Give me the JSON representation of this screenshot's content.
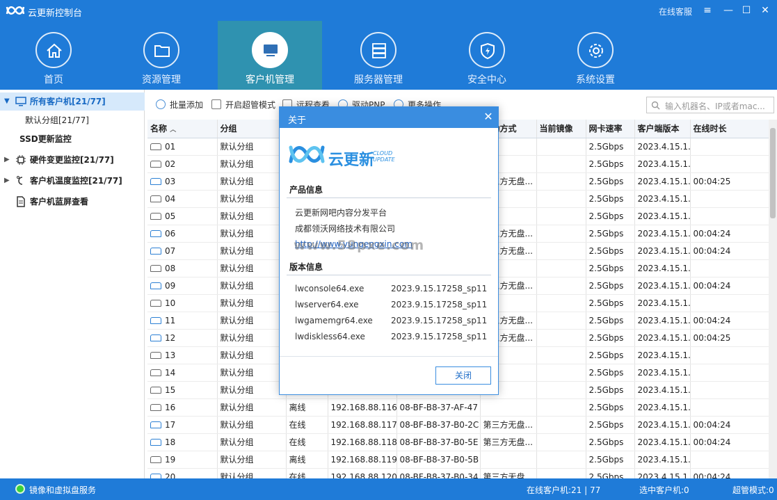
{
  "app": {
    "title": "云更新控制台",
    "online_service": "在线客服"
  },
  "nav": [
    {
      "label": "首页",
      "icon": "home-icon"
    },
    {
      "label": "资源管理",
      "icon": "folder-icon"
    },
    {
      "label": "客户机管理",
      "icon": "monitor-icon"
    },
    {
      "label": "服务器管理",
      "icon": "server-icon"
    },
    {
      "label": "安全中心",
      "icon": "shield-icon"
    },
    {
      "label": "系统设置",
      "icon": "gear-icon"
    }
  ],
  "sidebar": {
    "items": [
      {
        "label": "所有客户机[21/77]"
      },
      {
        "label": "默认分组[21/77]"
      },
      {
        "label": "SSD更新监控"
      },
      {
        "label": "硬件变更监控[21/77]"
      },
      {
        "label": "客户机温度监控[21/77]"
      },
      {
        "label": "客户机蓝屏查看"
      }
    ]
  },
  "toolbar": {
    "batch_add": "批量添加",
    "super_mode": "开启超管模式",
    "remote_view": "远程查看",
    "driver_pnp": "驱动PNP",
    "more": "更多操作",
    "search_placeholder": "输入机器名、IP或者mac..."
  },
  "table": {
    "headers": [
      "名称",
      "分组",
      "",
      "",
      "",
      "启动方式",
      "当前镜像",
      "网卡速率",
      "客户端版本",
      "在线时长"
    ],
    "rows": [
      {
        "name": "01",
        "group": "默认分组",
        "state": "",
        "ip": "",
        "mac": "",
        "boot": "",
        "image": "",
        "speed": "2.5Gbps",
        "ver": "2023.4.15.1...",
        "uptime": "",
        "on": false
      },
      {
        "name": "02",
        "group": "默认分组",
        "state": "",
        "ip": "",
        "mac": "",
        "boot": "",
        "image": "",
        "speed": "2.5Gbps",
        "ver": "2023.4.15.1...",
        "uptime": "",
        "on": false
      },
      {
        "name": "03",
        "group": "默认分组",
        "state": "",
        "ip": "",
        "mac": "",
        "boot": "第三方无盘...",
        "image": "",
        "speed": "2.5Gbps",
        "ver": "2023.4.15.1...",
        "uptime": "00:04:25",
        "on": true
      },
      {
        "name": "04",
        "group": "默认分组",
        "state": "",
        "ip": "",
        "mac": "",
        "boot": "",
        "image": "",
        "speed": "2.5Gbps",
        "ver": "2023.4.15.1...",
        "uptime": "",
        "on": false
      },
      {
        "name": "05",
        "group": "默认分组",
        "state": "",
        "ip": "",
        "mac": "",
        "boot": "",
        "image": "",
        "speed": "2.5Gbps",
        "ver": "2023.4.15.1...",
        "uptime": "",
        "on": false
      },
      {
        "name": "06",
        "group": "默认分组",
        "state": "",
        "ip": "",
        "mac": "",
        "boot": "第三方无盘...",
        "image": "",
        "speed": "2.5Gbps",
        "ver": "2023.4.15.1...",
        "uptime": "00:04:24",
        "on": true
      },
      {
        "name": "07",
        "group": "默认分组",
        "state": "",
        "ip": "",
        "mac": "",
        "boot": "第三方无盘...",
        "image": "",
        "speed": "2.5Gbps",
        "ver": "2023.4.15.1...",
        "uptime": "00:04:24",
        "on": true
      },
      {
        "name": "08",
        "group": "默认分组",
        "state": "",
        "ip": "",
        "mac": "",
        "boot": "",
        "image": "",
        "speed": "2.5Gbps",
        "ver": "2023.4.15.1...",
        "uptime": "",
        "on": false
      },
      {
        "name": "09",
        "group": "默认分组",
        "state": "",
        "ip": "",
        "mac": "",
        "boot": "第三方无盘...",
        "image": "",
        "speed": "2.5Gbps",
        "ver": "2023.4.15.1...",
        "uptime": "00:04:24",
        "on": true
      },
      {
        "name": "10",
        "group": "默认分组",
        "state": "",
        "ip": "",
        "mac": "",
        "boot": "",
        "image": "",
        "speed": "2.5Gbps",
        "ver": "2023.4.15.1...",
        "uptime": "",
        "on": false
      },
      {
        "name": "11",
        "group": "默认分组",
        "state": "",
        "ip": "",
        "mac": "",
        "boot": "第三方无盘...",
        "image": "",
        "speed": "2.5Gbps",
        "ver": "2023.4.15.1...",
        "uptime": "00:04:24",
        "on": true
      },
      {
        "name": "12",
        "group": "默认分组",
        "state": "",
        "ip": "",
        "mac": "",
        "boot": "第三方无盘...",
        "image": "",
        "speed": "2.5Gbps",
        "ver": "2023.4.15.1...",
        "uptime": "00:04:25",
        "on": true
      },
      {
        "name": "13",
        "group": "默认分组",
        "state": "",
        "ip": "",
        "mac": "",
        "boot": "",
        "image": "",
        "speed": "2.5Gbps",
        "ver": "2023.4.15.1...",
        "uptime": "",
        "on": false
      },
      {
        "name": "14",
        "group": "默认分组",
        "state": "",
        "ip": "",
        "mac": "",
        "boot": "",
        "image": "",
        "speed": "2.5Gbps",
        "ver": "2023.4.15.1...",
        "uptime": "",
        "on": false
      },
      {
        "name": "15",
        "group": "默认分组",
        "state": "",
        "ip": "",
        "mac": "",
        "boot": "",
        "image": "",
        "speed": "2.5Gbps",
        "ver": "2023.4.15.1...",
        "uptime": "",
        "on": false
      },
      {
        "name": "16",
        "group": "默认分组",
        "state": "离线",
        "ip": "192.168.88.116",
        "mac": "08-BF-B8-37-AF-47",
        "boot": "",
        "image": "",
        "speed": "2.5Gbps",
        "ver": "2023.4.15.1...",
        "uptime": "",
        "on": false
      },
      {
        "name": "17",
        "group": "默认分组",
        "state": "在线",
        "ip": "192.168.88.117",
        "mac": "08-BF-B8-37-B0-2C",
        "boot": "第三方无盘...",
        "image": "",
        "speed": "2.5Gbps",
        "ver": "2023.4.15.1...",
        "uptime": "00:04:24",
        "on": true
      },
      {
        "name": "18",
        "group": "默认分组",
        "state": "在线",
        "ip": "192.168.88.118",
        "mac": "08-BF-B8-37-B0-5E",
        "boot": "第三方无盘...",
        "image": "",
        "speed": "2.5Gbps",
        "ver": "2023.4.15.1...",
        "uptime": "00:04:24",
        "on": true
      },
      {
        "name": "19",
        "group": "默认分组",
        "state": "离线",
        "ip": "192.168.88.119",
        "mac": "08-BF-B8-37-B0-5B",
        "boot": "",
        "image": "",
        "speed": "2.5Gbps",
        "ver": "2023.4.15.1...",
        "uptime": "",
        "on": false
      },
      {
        "name": "20",
        "group": "默认分组",
        "state": "在线",
        "ip": "192.168.88.120",
        "mac": "08-BF-B8-37-B0-34",
        "boot": "第三方无盘...",
        "image": "",
        "speed": "2.5Gbps",
        "ver": "2023.4.15.1...",
        "uptime": "00:04:24",
        "on": true
      }
    ]
  },
  "status": {
    "service": "镜像和虚拟盘服务",
    "online_clients": "在线客户机:21 | 77",
    "selected": "选中客户机:0",
    "super_mode": "超管模式:0"
  },
  "dialog": {
    "title": "关于",
    "brand": "云更新",
    "brand_sub_1": "CLOUD",
    "brand_sub_2": "UPDATE",
    "product_heading": "产品信息",
    "product_name": "云更新网吧内容分发平台",
    "company": "成都领沃网络技术有限公司",
    "website": "http://www.yungengxin.com",
    "version_heading": "版本信息",
    "versions": [
      {
        "file": "lwconsole64.exe",
        "version": "2023.9.15.17258_sp11"
      },
      {
        "file": "lwserver64.exe",
        "version": "2023.9.15.17258_sp11"
      },
      {
        "file": "lwgamemgr64.exe",
        "version": "2023.9.15.17258_sp11"
      },
      {
        "file": "lwdiskless64.exe",
        "version": "2023.9.15.17258_sp11"
      }
    ],
    "close_button": "关闭",
    "watermark": "www.58pxe.com"
  },
  "colors": {
    "brand": "#1f7bd8",
    "nav_active": "#2f92b0",
    "accent": "#3a8de0"
  }
}
